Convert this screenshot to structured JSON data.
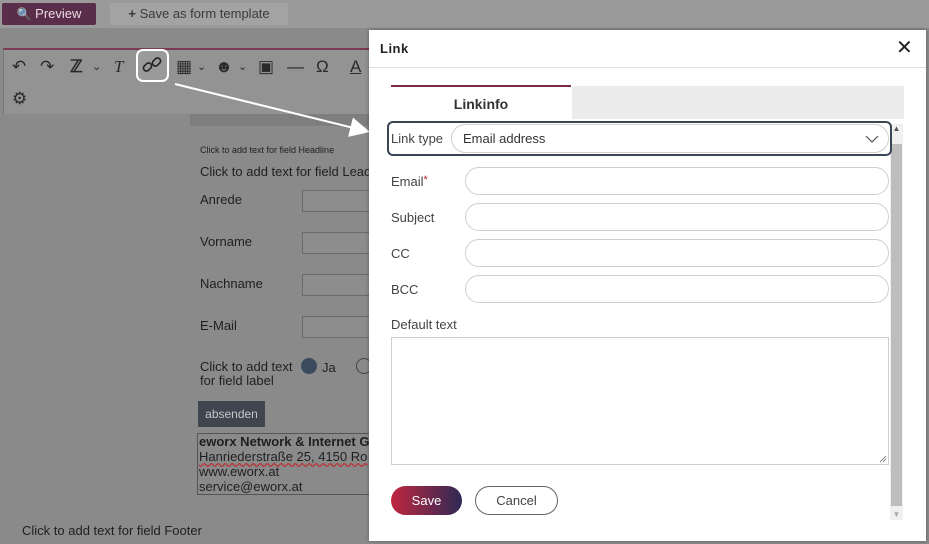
{
  "toolbar": {
    "preview_label": "Preview",
    "template_label": "Save as form template"
  },
  "editor": {
    "icons": [
      "undo-icon",
      "redo-icon",
      "format-painter-icon",
      "chevron-down-icon",
      "clear-format-icon",
      "link-icon",
      "table-icon",
      "emoji-icon",
      "image-icon",
      "horizontal-line-icon",
      "omega-icon",
      "text-color-icon",
      "accessibility-icon"
    ]
  },
  "form": {
    "headline": "Click to add text for field Headline",
    "lead": "Click to add text for field Lead",
    "anrede": "Anrede",
    "vorname": "Vorname",
    "nachname": "Nachname",
    "email": "E-Mail",
    "radio_label": "Click to add text for field label",
    "radio_ja": "Ja",
    "submit": "absenden",
    "address_line1": "eworx Network & Internet G",
    "address_line2": "Hanriederstraße 25, 4150 Ro",
    "address_line3": "www.eworx.at",
    "address_line4": "service@eworx.at",
    "footer": "Click to add text for field Footer"
  },
  "dialog": {
    "title": "Link",
    "close": "✕",
    "tab_label": "Linkinfo",
    "link_type_label": "Link type",
    "link_type_value": "Email address",
    "email_label": "Email",
    "required_mark": "*",
    "subject_label": "Subject",
    "cc_label": "CC",
    "bcc_label": "BCC",
    "default_text_label": "Default text",
    "save_label": "Save",
    "cancel_label": "Cancel"
  },
  "colors": {
    "accent": "#7b2b46",
    "save_gradient_start": "#c0263f",
    "save_gradient_end": "#2e2a55"
  }
}
